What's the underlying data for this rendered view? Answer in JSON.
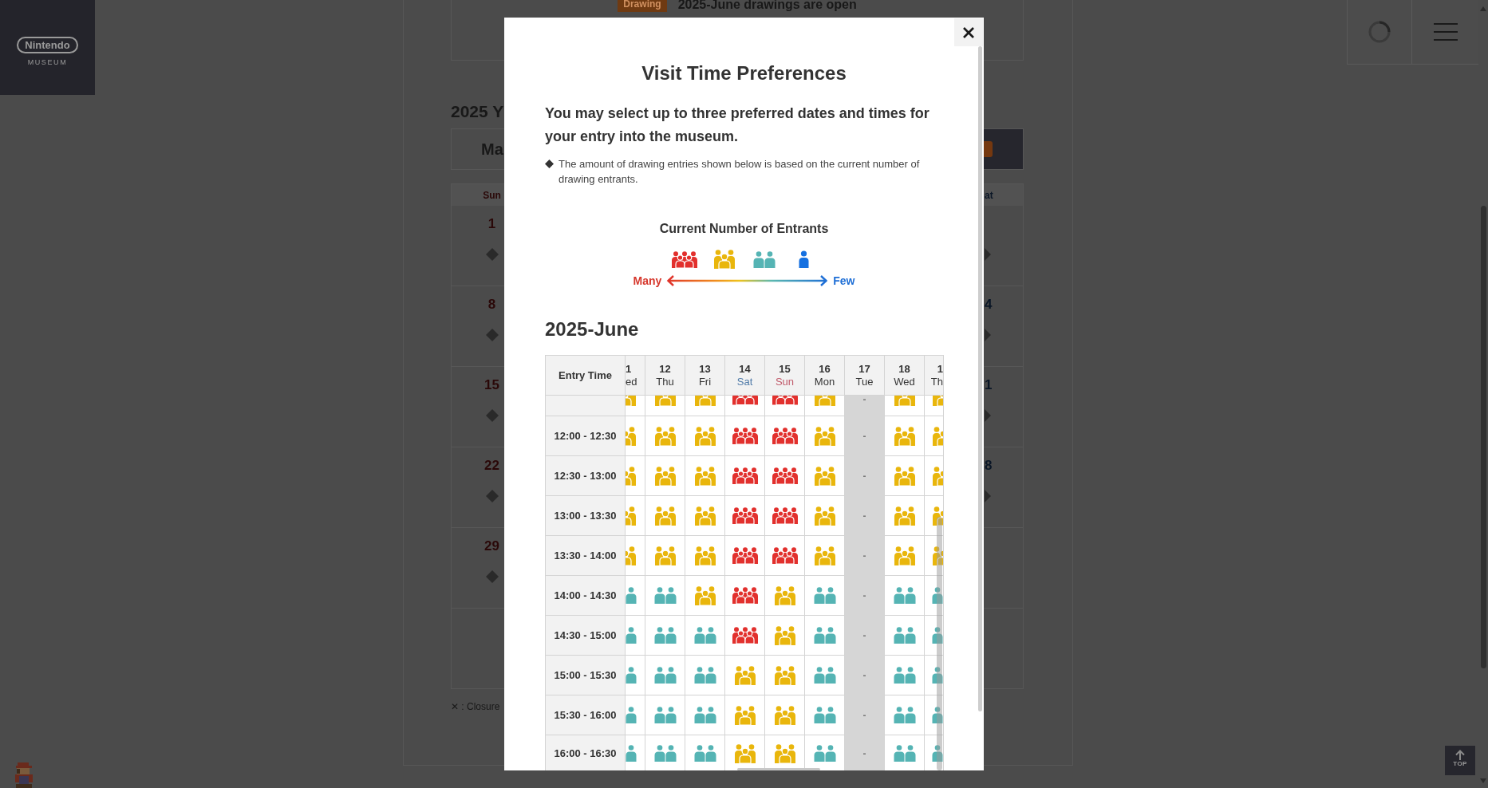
{
  "logo": {
    "wordmark": "Nintendo",
    "subtitle": "MUSEUM"
  },
  "announcement": {
    "badge": "Drawing",
    "text": "2025-June drawings are open"
  },
  "calendar": {
    "heading": "2025 Y",
    "month": "Ma",
    "columns": [
      {
        "label": "Sun",
        "kind": "sunday",
        "days": [
          {
            "day": "1",
            "marker": true
          },
          {
            "day": "8",
            "marker": true
          },
          {
            "day": "15",
            "marker": true
          },
          {
            "day": "22",
            "marker": true
          },
          {
            "day": "29",
            "marker": true
          },
          {
            "marker": false
          }
        ]
      },
      {
        "label": "at",
        "kind": "saturday",
        "days": [
          {
            "marker": true
          },
          {
            "day": "4",
            "marker": true
          },
          {
            "day": "1",
            "marker": true
          },
          {
            "day": "8",
            "marker": true
          },
          {
            "marker": false
          },
          {
            "marker": false
          }
        ]
      }
    ],
    "note": "✕ : Closure"
  },
  "top_button": {
    "label": "TOP"
  },
  "modal": {
    "title": "Visit Time Preferences",
    "intro": "You may select up to three preferred dates and times for your entry into the museum.",
    "note": "The amount of drawing entries shown below is based on the current number of drawing entrants.",
    "legend": {
      "title": "Current Number of Entrants",
      "levels": [
        {
          "kind": "many"
        },
        {
          "kind": "more"
        },
        {
          "kind": "some"
        },
        {
          "kind": "few"
        }
      ],
      "many_label": "Many",
      "few_label": "Few"
    },
    "month_heading": "2025-June",
    "table": {
      "corner": "Entry Time",
      "columns": [
        {
          "day": "1",
          "weekday": "ed",
          "kind": "weekday"
        },
        {
          "day": "12",
          "weekday": "Thu",
          "kind": "weekday"
        },
        {
          "day": "13",
          "weekday": "Fri",
          "kind": "weekday"
        },
        {
          "day": "14",
          "weekday": "Sat",
          "kind": "saturday"
        },
        {
          "day": "15",
          "weekday": "Sun",
          "kind": "sunday"
        },
        {
          "day": "16",
          "weekday": "Mon",
          "kind": "weekday"
        },
        {
          "day": "17",
          "weekday": "Tue",
          "kind": "weekday"
        },
        {
          "day": "18",
          "weekday": "Wed",
          "kind": "weekday"
        },
        {
          "day": "1",
          "weekday": "Th",
          "kind": "weekday"
        }
      ],
      "rows": [
        {
          "cells": [
            {
              "kind": "more"
            },
            {
              "kind": "more"
            },
            {
              "kind": "more"
            },
            {
              "kind": "many"
            },
            {
              "kind": "many"
            },
            {
              "kind": "more"
            },
            {
              "kind": "closed",
              "text": "-"
            },
            {
              "kind": "more"
            },
            {
              "kind": "more"
            }
          ]
        },
        {
          "time": "12:00 - 12:30",
          "cells": [
            {
              "kind": "more"
            },
            {
              "kind": "more"
            },
            {
              "kind": "more"
            },
            {
              "kind": "many"
            },
            {
              "kind": "many"
            },
            {
              "kind": "more"
            },
            {
              "kind": "closed",
              "text": "-"
            },
            {
              "kind": "more"
            },
            {
              "kind": "more"
            }
          ]
        },
        {
          "time": "12:30 - 13:00",
          "cells": [
            {
              "kind": "more"
            },
            {
              "kind": "more"
            },
            {
              "kind": "more"
            },
            {
              "kind": "many"
            },
            {
              "kind": "many"
            },
            {
              "kind": "more"
            },
            {
              "kind": "closed",
              "text": "-"
            },
            {
              "kind": "more"
            },
            {
              "kind": "more"
            }
          ]
        },
        {
          "time": "13:00 - 13:30",
          "cells": [
            {
              "kind": "more"
            },
            {
              "kind": "more"
            },
            {
              "kind": "more"
            },
            {
              "kind": "many"
            },
            {
              "kind": "many"
            },
            {
              "kind": "more"
            },
            {
              "kind": "closed",
              "text": "-"
            },
            {
              "kind": "more"
            },
            {
              "kind": "more"
            }
          ]
        },
        {
          "time": "13:30 - 14:00",
          "cells": [
            {
              "kind": "more"
            },
            {
              "kind": "more"
            },
            {
              "kind": "more"
            },
            {
              "kind": "many"
            },
            {
              "kind": "many"
            },
            {
              "kind": "more"
            },
            {
              "kind": "closed",
              "text": "-"
            },
            {
              "kind": "more"
            },
            {
              "kind": "more"
            }
          ]
        },
        {
          "time": "14:00 - 14:30",
          "cells": [
            {
              "kind": "some"
            },
            {
              "kind": "some"
            },
            {
              "kind": "more"
            },
            {
              "kind": "many"
            },
            {
              "kind": "more"
            },
            {
              "kind": "some"
            },
            {
              "kind": "closed",
              "text": "-"
            },
            {
              "kind": "some"
            },
            {
              "kind": "some"
            }
          ]
        },
        {
          "time": "14:30 - 15:00",
          "cells": [
            {
              "kind": "some"
            },
            {
              "kind": "some"
            },
            {
              "kind": "some"
            },
            {
              "kind": "many"
            },
            {
              "kind": "more"
            },
            {
              "kind": "some"
            },
            {
              "kind": "closed",
              "text": "-"
            },
            {
              "kind": "some"
            },
            {
              "kind": "some"
            }
          ]
        },
        {
          "time": "15:00 - 15:30",
          "cells": [
            {
              "kind": "some"
            },
            {
              "kind": "some"
            },
            {
              "kind": "some"
            },
            {
              "kind": "more"
            },
            {
              "kind": "more"
            },
            {
              "kind": "some"
            },
            {
              "kind": "closed",
              "text": "-"
            },
            {
              "kind": "some"
            },
            {
              "kind": "some"
            }
          ]
        },
        {
          "time": "15:30 - 16:00",
          "cells": [
            {
              "kind": "some"
            },
            {
              "kind": "some"
            },
            {
              "kind": "some"
            },
            {
              "kind": "more"
            },
            {
              "kind": "more"
            },
            {
              "kind": "some"
            },
            {
              "kind": "closed",
              "text": "-"
            },
            {
              "kind": "some"
            },
            {
              "kind": "some"
            }
          ]
        },
        {
          "time": "16:00 - 16:30",
          "cells": [
            {
              "kind": "some"
            },
            {
              "kind": "some"
            },
            {
              "kind": "some"
            },
            {
              "kind": "more"
            },
            {
              "kind": "more"
            },
            {
              "kind": "some"
            },
            {
              "kind": "closed",
              "text": "-"
            },
            {
              "kind": "some"
            },
            {
              "kind": "some"
            }
          ]
        }
      ]
    }
  }
}
